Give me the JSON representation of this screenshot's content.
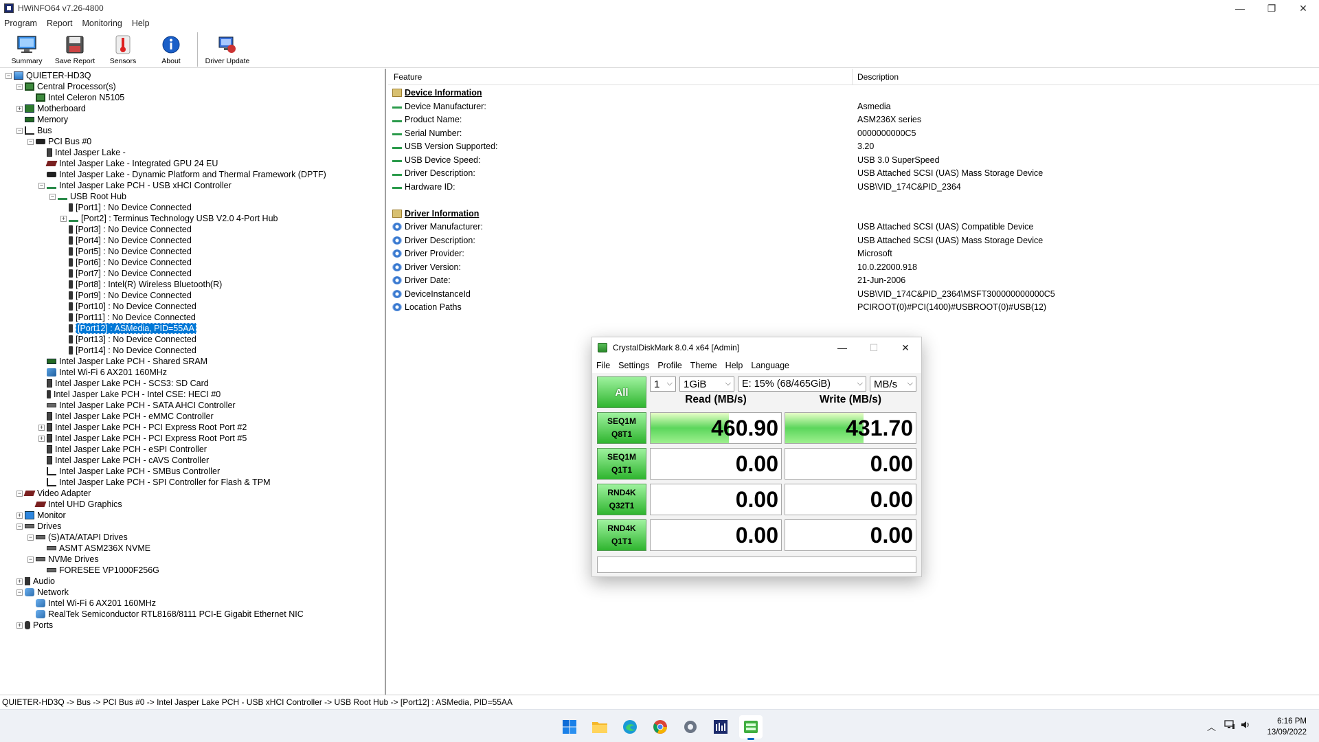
{
  "window": {
    "title": "HWiNFO64 v7.26-4800",
    "controls": {
      "minimize": "—",
      "restore": "❐",
      "close": "✕"
    }
  },
  "menu": [
    "Program",
    "Report",
    "Monitoring",
    "Help"
  ],
  "toolbar": [
    {
      "label": "Summary",
      "icon": "monitor-icon"
    },
    {
      "label": "Save Report",
      "icon": "floppy-disk-icon"
    },
    {
      "label": "Sensors",
      "icon": "thermometer-icon"
    },
    {
      "label": "About",
      "icon": "info-icon"
    },
    {
      "label": "Driver Update",
      "icon": "driver-update-icon"
    }
  ],
  "tree": [
    {
      "d": 0,
      "t": "−",
      "i": "comp",
      "label": "QUIETER-HD3Q"
    },
    {
      "d": 1,
      "t": "−",
      "i": "cpu",
      "label": "Central Processor(s)"
    },
    {
      "d": 2,
      "t": "",
      "i": "cpu",
      "label": "Intel Celeron N5105"
    },
    {
      "d": 1,
      "t": "+",
      "i": "mb",
      "label": "Motherboard"
    },
    {
      "d": 1,
      "t": "",
      "i": "mem",
      "label": "Memory"
    },
    {
      "d": 1,
      "t": "−",
      "i": "bus",
      "label": "Bus"
    },
    {
      "d": 2,
      "t": "−",
      "i": "pci",
      "label": "PCI Bus #0"
    },
    {
      "d": 3,
      "t": "",
      "i": "chip",
      "label": "Intel Jasper Lake -"
    },
    {
      "d": 3,
      "t": "",
      "i": "gpu",
      "label": "Intel Jasper Lake - Integrated GPU 24 EU"
    },
    {
      "d": 3,
      "t": "",
      "i": "pci",
      "label": "Intel Jasper Lake - Dynamic Platform and Thermal Framework (DPTF)"
    },
    {
      "d": 3,
      "t": "−",
      "i": "usb",
      "label": "Intel Jasper Lake PCH - USB xHCI Controller"
    },
    {
      "d": 4,
      "t": "−",
      "i": "usb",
      "label": "USB Root Hub"
    },
    {
      "d": 5,
      "t": "",
      "i": "port",
      "label": "[Port1] : No Device Connected"
    },
    {
      "d": 5,
      "t": "+",
      "i": "usb",
      "label": "[Port2] : Terminus Technology USB V2.0 4-Port Hub"
    },
    {
      "d": 5,
      "t": "",
      "i": "port",
      "label": "[Port3] : No Device Connected"
    },
    {
      "d": 5,
      "t": "",
      "i": "port",
      "label": "[Port4] : No Device Connected"
    },
    {
      "d": 5,
      "t": "",
      "i": "port",
      "label": "[Port5] : No Device Connected"
    },
    {
      "d": 5,
      "t": "",
      "i": "port",
      "label": "[Port6] : No Device Connected"
    },
    {
      "d": 5,
      "t": "",
      "i": "port",
      "label": "[Port7] : No Device Connected"
    },
    {
      "d": 5,
      "t": "",
      "i": "port",
      "label": "[Port8] : Intel(R) Wireless Bluetooth(R)"
    },
    {
      "d": 5,
      "t": "",
      "i": "port",
      "label": "[Port9] : No Device Connected"
    },
    {
      "d": 5,
      "t": "",
      "i": "port",
      "label": "[Port10] : No Device Connected"
    },
    {
      "d": 5,
      "t": "",
      "i": "port",
      "label": "[Port11] : No Device Connected"
    },
    {
      "d": 5,
      "t": "",
      "i": "port",
      "label": "[Port12] : ASMedia, PID=55AA",
      "sel": true
    },
    {
      "d": 5,
      "t": "",
      "i": "port",
      "label": "[Port13] : No Device Connected"
    },
    {
      "d": 5,
      "t": "",
      "i": "port",
      "label": "[Port14] : No Device Connected"
    },
    {
      "d": 3,
      "t": "",
      "i": "mem",
      "label": "Intel Jasper Lake PCH - Shared SRAM"
    },
    {
      "d": 3,
      "t": "",
      "i": "wifi",
      "label": "Intel Wi-Fi 6 AX201 160MHz"
    },
    {
      "d": 3,
      "t": "",
      "i": "chip",
      "label": "Intel Jasper Lake PCH - SCS3: SD Card"
    },
    {
      "d": 3,
      "t": "",
      "i": "port",
      "label": "Intel Jasper Lake PCH - Intel CSE: HECI #0"
    },
    {
      "d": 3,
      "t": "",
      "i": "drive",
      "label": "Intel Jasper Lake PCH - SATA AHCI Controller"
    },
    {
      "d": 3,
      "t": "",
      "i": "chip",
      "label": "Intel Jasper Lake PCH - eMMC Controller"
    },
    {
      "d": 3,
      "t": "+",
      "i": "chip",
      "label": "Intel Jasper Lake PCH - PCI Express Root Port #2"
    },
    {
      "d": 3,
      "t": "+",
      "i": "chip",
      "label": "Intel Jasper Lake PCH - PCI Express Root Port #5"
    },
    {
      "d": 3,
      "t": "",
      "i": "chip",
      "label": "Intel Jasper Lake PCH - eSPI Controller"
    },
    {
      "d": 3,
      "t": "",
      "i": "chip",
      "label": "Intel Jasper Lake PCH - cAVS Controller"
    },
    {
      "d": 3,
      "t": "",
      "i": "bus",
      "label": "Intel Jasper Lake PCH - SMBus Controller"
    },
    {
      "d": 3,
      "t": "",
      "i": "bus",
      "label": "Intel Jasper Lake PCH - SPI Controller for Flash & TPM"
    },
    {
      "d": 1,
      "t": "−",
      "i": "gpu",
      "label": "Video Adapter"
    },
    {
      "d": 2,
      "t": "",
      "i": "gpu",
      "label": "Intel UHD Graphics"
    },
    {
      "d": 1,
      "t": "+",
      "i": "mon",
      "label": "Monitor"
    },
    {
      "d": 1,
      "t": "−",
      "i": "drive",
      "label": "Drives"
    },
    {
      "d": 2,
      "t": "−",
      "i": "drive",
      "label": "(S)ATA/ATAPI Drives"
    },
    {
      "d": 3,
      "t": "",
      "i": "drive",
      "label": "ASMT ASM236X NVME"
    },
    {
      "d": 2,
      "t": "−",
      "i": "drive",
      "label": "NVMe Drives"
    },
    {
      "d": 3,
      "t": "",
      "i": "drive",
      "label": "FORESEE VP1000F256G"
    },
    {
      "d": 1,
      "t": "+",
      "i": "aud",
      "label": "Audio"
    },
    {
      "d": 1,
      "t": "−",
      "i": "net",
      "label": "Network"
    },
    {
      "d": 2,
      "t": "",
      "i": "net",
      "label": "Intel Wi-Fi 6 AX201 160MHz"
    },
    {
      "d": 2,
      "t": "",
      "i": "net",
      "label": "RealTek Semiconductor RTL8168/8111 PCI-E Gigabit Ethernet NIC"
    },
    {
      "d": 1,
      "t": "+",
      "i": "ports",
      "label": "Ports"
    }
  ],
  "details": {
    "headers": {
      "feature": "Feature",
      "description": "Description"
    },
    "rows": [
      {
        "kind": "section",
        "label": "Device Information",
        "value": ""
      },
      {
        "kind": "usb",
        "label": "Device Manufacturer:",
        "value": "Asmedia"
      },
      {
        "kind": "usb",
        "label": "Product Name:",
        "value": "ASM236X series"
      },
      {
        "kind": "usb",
        "label": "Serial Number:",
        "value": "0000000000C5"
      },
      {
        "kind": "usb",
        "label": "USB Version Supported:",
        "value": "3.20"
      },
      {
        "kind": "usb",
        "label": "USB Device Speed:",
        "value": "USB 3.0 SuperSpeed"
      },
      {
        "kind": "usb",
        "label": "Driver Description:",
        "value": "USB Attached SCSI (UAS) Mass Storage Device"
      },
      {
        "kind": "usb",
        "label": "Hardware ID:",
        "value": "USB\\VID_174C&PID_2364"
      },
      {
        "kind": "blank",
        "label": "",
        "value": ""
      },
      {
        "kind": "section",
        "label": "Driver Information",
        "value": ""
      },
      {
        "kind": "gear",
        "label": "Driver Manufacturer:",
        "value": "USB Attached SCSI (UAS) Compatible Device"
      },
      {
        "kind": "gear",
        "label": "Driver Description:",
        "value": "USB Attached SCSI (UAS) Mass Storage Device"
      },
      {
        "kind": "gear",
        "label": "Driver Provider:",
        "value": "Microsoft"
      },
      {
        "kind": "gear",
        "label": "Driver Version:",
        "value": "10.0.22000.918"
      },
      {
        "kind": "gear",
        "label": "Driver Date:",
        "value": "21-Jun-2006"
      },
      {
        "kind": "gear",
        "label": "DeviceInstanceId",
        "value": "USB\\VID_174C&PID_2364\\MSFT300000000000C5"
      },
      {
        "kind": "gear",
        "label": "Location Paths",
        "value": "PCIROOT(0)#PCI(1400)#USBROOT(0)#USB(12)"
      }
    ]
  },
  "statusbar": "QUIETER-HD3Q -> Bus -> PCI Bus #0 -> Intel Jasper Lake PCH - USB xHCI Controller -> USB Root Hub -> [Port12] : ASMedia, PID=55AA",
  "cdm": {
    "title": "CrystalDiskMark 8.0.4 x64 [Admin]",
    "controls": {
      "minimize": "—",
      "maximize": "☐",
      "close": "✕"
    },
    "menu": [
      "File",
      "Settings",
      "Profile",
      "Theme",
      "Help",
      "Language"
    ],
    "all_label": "All",
    "count": "1",
    "size": "1GiB",
    "drive": "E: 15% (68/465GiB)",
    "unit": "MB/s",
    "read_header": "Read (MB/s)",
    "write_header": "Write (MB/s)",
    "tests": [
      {
        "l1": "SEQ1M",
        "l2": "Q8T1",
        "read": "460.90",
        "write": "431.70",
        "read_fill": 0.6,
        "write_fill": 0.6
      },
      {
        "l1": "SEQ1M",
        "l2": "Q1T1",
        "read": "0.00",
        "write": "0.00",
        "read_fill": 0,
        "write_fill": 0
      },
      {
        "l1": "RND4K",
        "l2": "Q32T1",
        "read": "0.00",
        "write": "0.00",
        "read_fill": 0,
        "write_fill": 0
      },
      {
        "l1": "RND4K",
        "l2": "Q1T1",
        "read": "0.00",
        "write": "0.00",
        "read_fill": 0,
        "write_fill": 0
      }
    ],
    "comment": ""
  },
  "taskbar": {
    "apps": [
      "windows-start-icon",
      "file-explorer-icon",
      "edge-icon",
      "chrome-icon",
      "settings-icon",
      "hwinfo-icon",
      "crystaldiskmark-icon"
    ],
    "tray_icons": [
      "chevron-up-icon",
      "network-icon",
      "volume-icon"
    ],
    "time": "6:16 PM",
    "date": "13/09/2022"
  }
}
